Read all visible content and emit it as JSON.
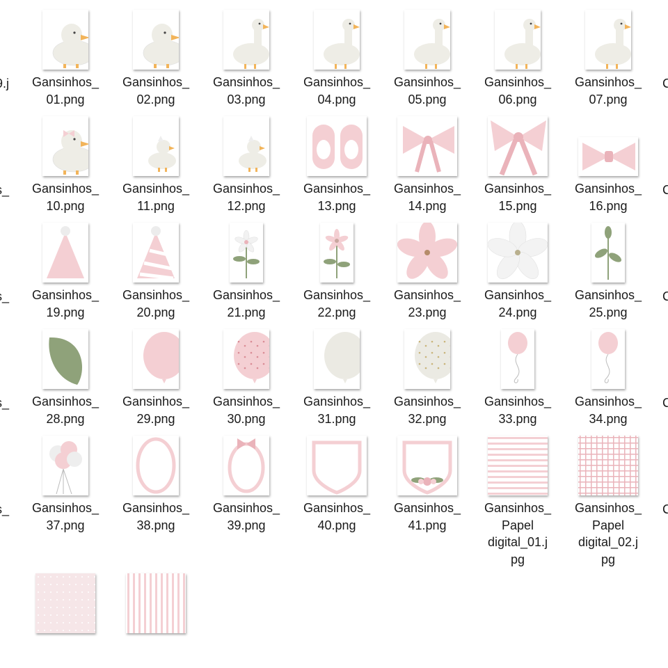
{
  "files": [
    {
      "row": 0,
      "col": 0,
      "name": "Gansinhos_01.png",
      "line1": "Gansinhos_",
      "line2": "01.png",
      "art": "duck",
      "shape": "portrait"
    },
    {
      "row": 0,
      "col": 1,
      "name": "Gansinhos_02.png",
      "line1": "Gansinhos_",
      "line2": "02.png",
      "art": "duck",
      "shape": "portrait"
    },
    {
      "row": 0,
      "col": 2,
      "name": "Gansinhos_03.png",
      "line1": "Gansinhos_",
      "line2": "03.png",
      "art": "duck-tall",
      "shape": "portrait"
    },
    {
      "row": 0,
      "col": 3,
      "name": "Gansinhos_04.png",
      "line1": "Gansinhos_",
      "line2": "04.png",
      "art": "duck-tall",
      "shape": "portrait"
    },
    {
      "row": 0,
      "col": 4,
      "name": "Gansinhos_05.png",
      "line1": "Gansinhos_",
      "line2": "05.png",
      "art": "duck-tall",
      "shape": "portrait"
    },
    {
      "row": 0,
      "col": 5,
      "name": "Gansinhos_06.png",
      "line1": "Gansinhos_",
      "line2": "06.png",
      "art": "duck-tall",
      "shape": "portrait"
    },
    {
      "row": 0,
      "col": 6,
      "name": "Gansinhos_07.png",
      "line1": "Gansinhos_",
      "line2": "07.png",
      "art": "duck-tall",
      "shape": "portrait"
    },
    {
      "row": 1,
      "col": 0,
      "name": "Gansinhos_10.png",
      "line1": "Gansinhos_",
      "line2": "10.png",
      "art": "duck-bow",
      "shape": "portrait"
    },
    {
      "row": 1,
      "col": 1,
      "name": "Gansinhos_11.png",
      "line1": "Gansinhos_",
      "line2": "11.png",
      "art": "duck-small",
      "shape": "portrait"
    },
    {
      "row": 1,
      "col": 2,
      "name": "Gansinhos_12.png",
      "line1": "Gansinhos_",
      "line2": "12.png",
      "art": "duck-small",
      "shape": "portrait"
    },
    {
      "row": 1,
      "col": 3,
      "name": "Gansinhos_13.png",
      "line1": "Gansinhos_",
      "line2": "13.png",
      "art": "shoes",
      "shape": "square"
    },
    {
      "row": 1,
      "col": 4,
      "name": "Gansinhos_14.png",
      "line1": "Gansinhos_",
      "line2": "14.png",
      "art": "bow",
      "shape": "square"
    },
    {
      "row": 1,
      "col": 5,
      "name": "Gansinhos_15.png",
      "line1": "Gansinhos_",
      "line2": "15.png",
      "art": "bow-big",
      "shape": "square"
    },
    {
      "row": 1,
      "col": 6,
      "name": "Gansinhos_16.png",
      "line1": "Gansinhos_",
      "line2": "16.png",
      "art": "bowtie",
      "shape": "wide"
    },
    {
      "row": 2,
      "col": 0,
      "name": "Gansinhos_19.png",
      "line1": "Gansinhos_",
      "line2": "19.png",
      "art": "hat",
      "shape": "portrait"
    },
    {
      "row": 2,
      "col": 1,
      "name": "Gansinhos_20.png",
      "line1": "Gansinhos_",
      "line2": "20.png",
      "art": "hat-striped",
      "shape": "portrait"
    },
    {
      "row": 2,
      "col": 2,
      "name": "Gansinhos_21.png",
      "line1": "Gansinhos_",
      "line2": "21.png",
      "art": "flower-white",
      "shape": "narrow"
    },
    {
      "row": 2,
      "col": 3,
      "name": "Gansinhos_22.png",
      "line1": "Gansinhos_",
      "line2": "22.png",
      "art": "flower-pink",
      "shape": "narrow"
    },
    {
      "row": 2,
      "col": 4,
      "name": "Gansinhos_23.png",
      "line1": "Gansinhos_",
      "line2": "23.png",
      "art": "petals-pink",
      "shape": "square"
    },
    {
      "row": 2,
      "col": 5,
      "name": "Gansinhos_24.png",
      "line1": "Gansinhos_",
      "line2": "24.png",
      "art": "petals-white",
      "shape": "square"
    },
    {
      "row": 2,
      "col": 6,
      "name": "Gansinhos_25.png",
      "line1": "Gansinhos_",
      "line2": "25.png",
      "art": "sprig",
      "shape": "narrow"
    },
    {
      "row": 3,
      "col": 0,
      "name": "Gansinhos_28.png",
      "line1": "Gansinhos_",
      "line2": "28.png",
      "art": "leaf",
      "shape": "portrait"
    },
    {
      "row": 3,
      "col": 1,
      "name": "Gansinhos_29.png",
      "line1": "Gansinhos_",
      "line2": "29.png",
      "art": "balloon-pink",
      "shape": "portrait"
    },
    {
      "row": 3,
      "col": 2,
      "name": "Gansinhos_30.png",
      "line1": "Gansinhos_",
      "line2": "30.png",
      "art": "balloon-dots",
      "shape": "portrait"
    },
    {
      "row": 3,
      "col": 3,
      "name": "Gansinhos_31.png",
      "line1": "Gansinhos_",
      "line2": "31.png",
      "art": "balloon-white",
      "shape": "portrait"
    },
    {
      "row": 3,
      "col": 4,
      "name": "Gansinhos_32.png",
      "line1": "Gansinhos_",
      "line2": "32.png",
      "art": "balloon-white-dots",
      "shape": "portrait"
    },
    {
      "row": 3,
      "col": 5,
      "name": "Gansinhos_33.png",
      "line1": "Gansinhos_",
      "line2": "33.png",
      "art": "balloon-string",
      "shape": "narrow"
    },
    {
      "row": 3,
      "col": 6,
      "name": "Gansinhos_34.png",
      "line1": "Gansinhos_",
      "line2": "34.png",
      "art": "balloon-string",
      "shape": "narrow"
    },
    {
      "row": 4,
      "col": 0,
      "name": "Gansinhos_37.png",
      "line1": "Gansinhos_",
      "line2": "37.png",
      "art": "balloon-bunch",
      "shape": "portrait"
    },
    {
      "row": 4,
      "col": 1,
      "name": "Gansinhos_38.png",
      "line1": "Gansinhos_",
      "line2": "38.png",
      "art": "frame-oval",
      "shape": "portrait"
    },
    {
      "row": 4,
      "col": 2,
      "name": "Gansinhos_39.png",
      "line1": "Gansinhos_",
      "line2": "39.png",
      "art": "frame-oval-bow",
      "shape": "portrait"
    },
    {
      "row": 4,
      "col": 3,
      "name": "Gansinhos_40.png",
      "line1": "Gansinhos_",
      "line2": "40.png",
      "art": "frame-shield",
      "shape": "square"
    },
    {
      "row": 4,
      "col": 4,
      "name": "Gansinhos_41.png",
      "line1": "Gansinhos_",
      "line2": "41.png",
      "art": "frame-shield-flowers",
      "shape": "square"
    },
    {
      "row": 4,
      "col": 5,
      "name": "Gansinhos_Papel digital_01.jpg",
      "line1": "Gansinhos_",
      "line2": "Papel",
      "line3": "digital_01.j",
      "line4": "pg",
      "art": "paper-stripes",
      "shape": "square"
    },
    {
      "row": 4,
      "col": 6,
      "name": "Gansinhos_Papel digital_02.jpg",
      "line1": "Gansinhos_",
      "line2": "Papel",
      "line3": "digital_02.j",
      "line4": "pg",
      "art": "paper-plaid",
      "shape": "square"
    },
    {
      "row": 5,
      "col": 0,
      "name": "",
      "art": "paper-dots",
      "shape": "square"
    },
    {
      "row": 5,
      "col": 1,
      "name": "",
      "art": "paper-vstripes",
      "shape": "square"
    }
  ],
  "edge_left": [
    {
      "row": 0,
      "text": "9.j"
    },
    {
      "row": 1,
      "text": "s_"
    },
    {
      "row": 2,
      "text": "s_"
    },
    {
      "row": 3,
      "text": "s_"
    },
    {
      "row": 4,
      "text": "s_"
    }
  ],
  "edge_right": [
    {
      "row": 0,
      "text": "C"
    },
    {
      "row": 1,
      "text": "C"
    },
    {
      "row": 2,
      "text": "C"
    },
    {
      "row": 3,
      "text": "C"
    },
    {
      "row": 4,
      "text": "C"
    }
  ],
  "colors": {
    "pink": "#f4cfd3",
    "pink_dark": "#eab3ba",
    "cream": "#eeede6",
    "green": "#8fa27a",
    "beak": "#f2b45a"
  }
}
